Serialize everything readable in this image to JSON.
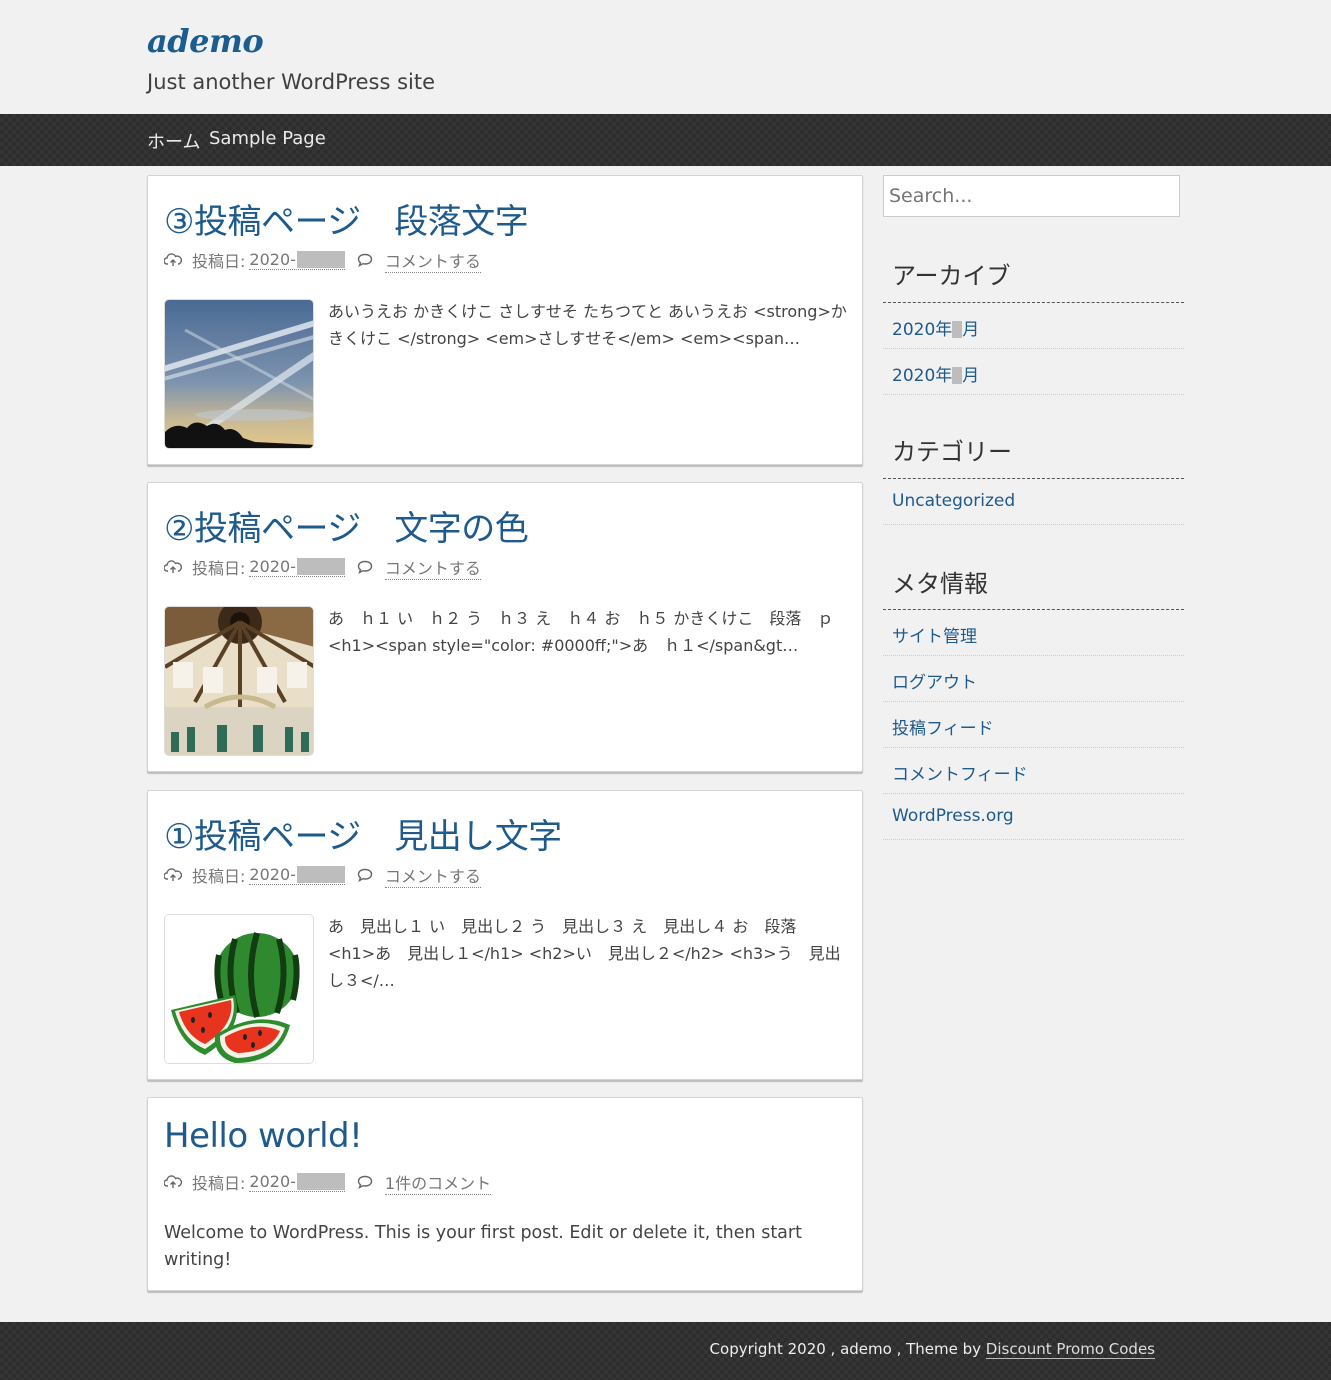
{
  "header": {
    "site_title": "ademo",
    "tagline": "Just another WordPress site"
  },
  "nav": {
    "items": [
      {
        "label": "ホーム"
      },
      {
        "label": "Sample Page"
      }
    ]
  },
  "posts": [
    {
      "title": "③投稿ページ　段落文字",
      "date_label": "投稿日:",
      "date_prefix": "2020-",
      "comment_label": "コメントする",
      "excerpt": "あいうえお かきくけこ さしすせそ たちつてと あいうえお <strong>かきくけこ </strong> <em>さしすせそ</em> <em><span…",
      "thumbnail": "sky-contrails"
    },
    {
      "title": "②投稿ページ　文字の色",
      "date_label": "投稿日:",
      "date_prefix": "2020-",
      "comment_label": "コメントする",
      "excerpt": "あ　ｈ１ い　ｈ２ う　ｈ３ え　ｈ４ お　ｈ５ かきくけこ　段落　ｐ <h1><span style=\"color: #0000ff;\">あ　ｈ１</span&gt…",
      "thumbnail": "dome-ceiling"
    },
    {
      "title": "①投稿ページ　見出し文字",
      "date_label": "投稿日:",
      "date_prefix": "2020-",
      "comment_label": "コメントする",
      "excerpt": "あ　見出し１ い　見出し２ う　見出し３ え　見出し４ お　段落 <h1>あ　見出し１</h1> <h2>い　見出し２</h2> <h3>う　見出し３</…",
      "thumbnail": "watermelon"
    },
    {
      "title": "Hello world!",
      "date_label": "投稿日:",
      "date_prefix": "2020-",
      "comment_label": "1件のコメント",
      "excerpt": "Welcome to WordPress. This is your first post. Edit or delete it, then start writing!"
    }
  ],
  "sidebar": {
    "search_placeholder": "Search...",
    "archives": {
      "title": "アーカイブ",
      "items": [
        {
          "prefix": "2020年",
          "suffix": "月"
        },
        {
          "prefix": "2020年",
          "suffix": "月"
        }
      ]
    },
    "categories": {
      "title": "カテゴリー",
      "items": [
        {
          "label": "Uncategorized"
        }
      ]
    },
    "meta": {
      "title": "メタ情報",
      "items": [
        {
          "label": "サイト管理"
        },
        {
          "label": "ログアウト"
        },
        {
          "label": "投稿フィード"
        },
        {
          "label": "コメントフィード"
        },
        {
          "label": "WordPress.org"
        }
      ]
    }
  },
  "footer": {
    "text": "Copyright 2020 , ademo , Theme by ",
    "link": "Discount Promo Codes"
  },
  "colors": {
    "link": "#1e5a8c",
    "background": "#f1f1f1",
    "bar": "#2d2d2d"
  }
}
